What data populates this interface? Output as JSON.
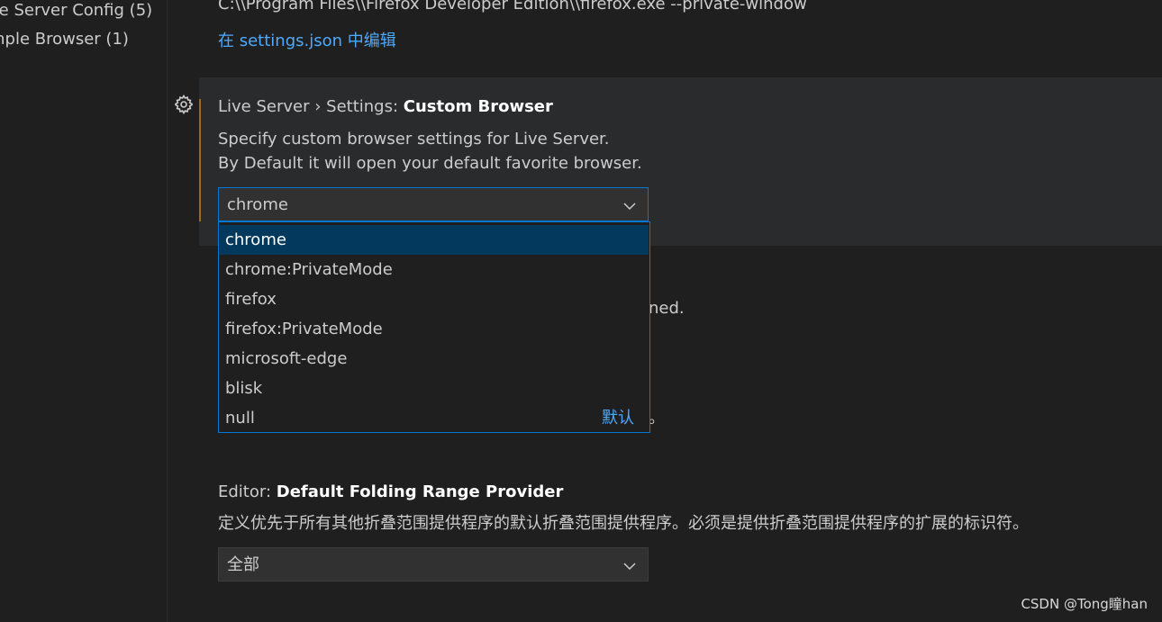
{
  "tree": {
    "items": [
      {
        "label": "ve Server Config (5)"
      },
      {
        "label": "mple Browser (1)"
      }
    ]
  },
  "previous_setting": {
    "value_text": "C:\\\\Program Files\\\\Firefox Developer Edition\\\\firefox.exe --private-window",
    "edit_link": "在 settings.json 中编辑"
  },
  "custom_browser": {
    "category": "Live Server › Settings: ",
    "name": "Custom Browser",
    "description_line1": "Specify custom browser settings for Live Server.",
    "description_line2": "By Default it will open your default favorite browser.",
    "selected_value": "chrome",
    "options": [
      {
        "label": "chrome",
        "selected": true
      },
      {
        "label": "chrome:PrivateMode"
      },
      {
        "label": "firefox"
      },
      {
        "label": "firefox:PrivateMode"
      },
      {
        "label": "microsoft-edge"
      },
      {
        "label": "blisk"
      },
      {
        "label": "null",
        "tag": "默认"
      }
    ]
  },
  "hidden_fragments": {
    "fragment1": "ned.",
    "fragment2": "。"
  },
  "folding_provider": {
    "category": "Editor: ",
    "name": "Default Folding Range Provider",
    "description": "定义优先于所有其他折叠范围提供程序的默认折叠范围提供程序。必须是提供折叠范围提供程序的扩展的标识符。",
    "selected_value": "全部"
  },
  "watermark": "CSDN @Tong瞳han",
  "colors": {
    "accent": "#0078d4",
    "link": "#4daafc",
    "selected_option_bg": "#04395e",
    "focus_bar": "#9a6b24"
  },
  "icons": {
    "gear": "gear-icon",
    "chevron": "chevron-down-icon"
  }
}
